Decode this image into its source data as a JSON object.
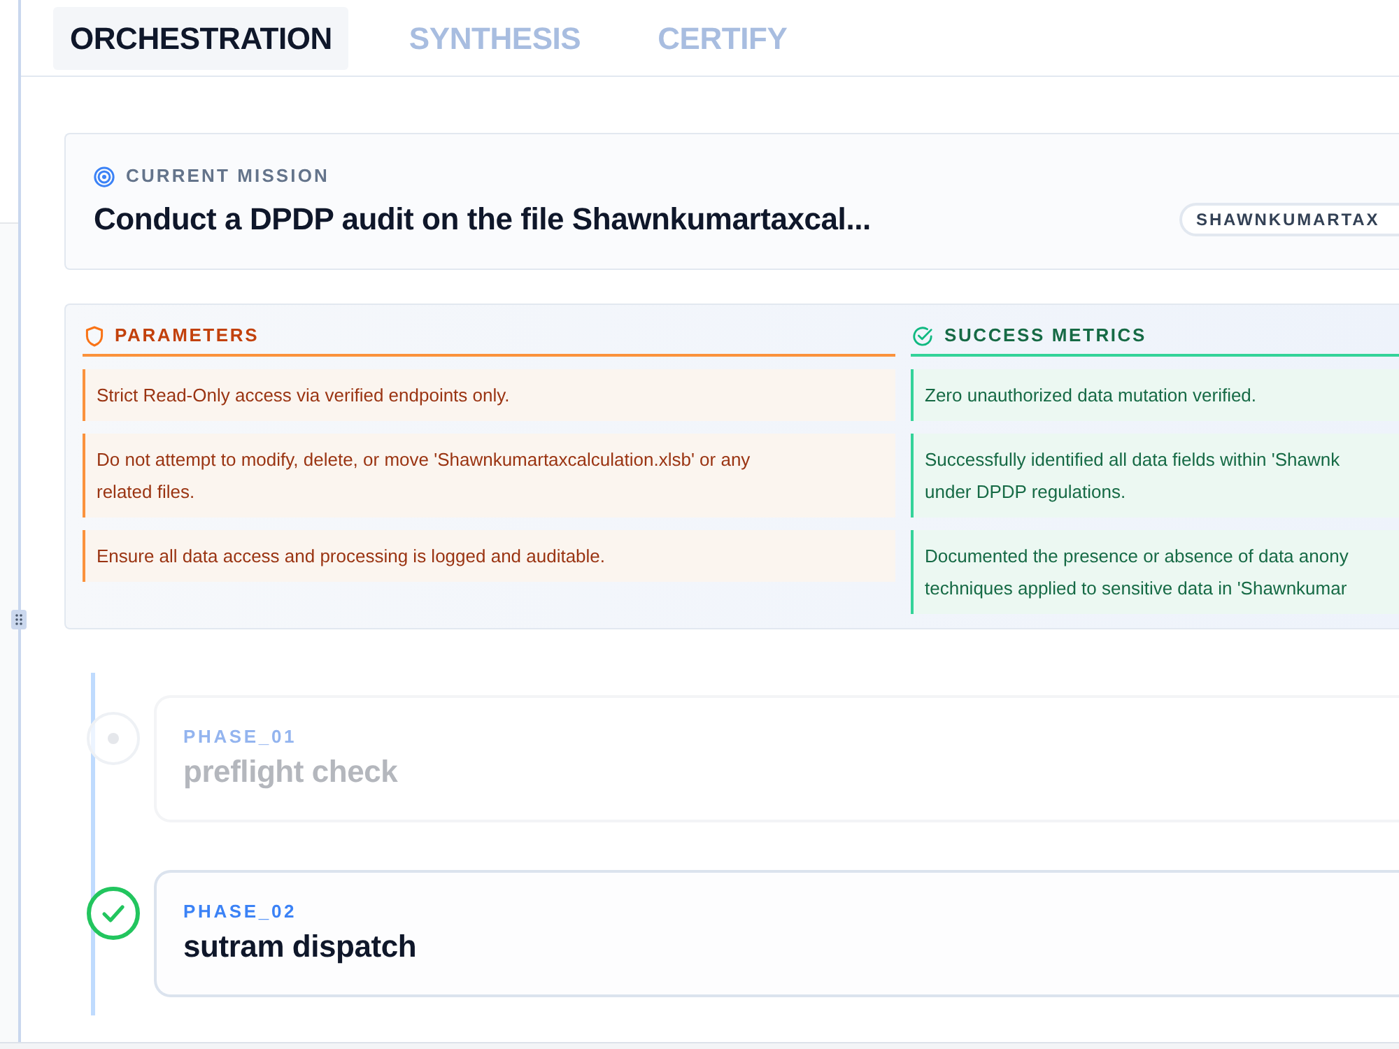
{
  "tabs": [
    {
      "label": "ORCHESTRATION",
      "selected": true
    },
    {
      "label": "SYNTHESIS",
      "selected": false
    },
    {
      "label": "CERTIFY",
      "selected": false
    }
  ],
  "mission": {
    "label": "CURRENT MISSION",
    "title": "Conduct a DPDP audit on the file Shawnkumartaxcal...",
    "badge": "SHAWNKUMARTAX"
  },
  "parameters": {
    "heading": "PARAMETERS",
    "items": [
      "Strict Read-Only access via verified endpoints only.",
      "Do not attempt to modify, delete, or move 'Shawnkumartaxcalculation.xlsb' or any\nrelated files.",
      "Ensure all data access and processing is logged and auditable."
    ]
  },
  "success_metrics": {
    "heading": "SUCCESS METRICS",
    "items": [
      "Zero unauthorized data mutation verified.",
      "Successfully identified all data fields within 'Shawnk\nunder DPDP regulations.",
      "Documented the presence or absence of data anony\ntechniques applied to sensitive data in 'Shawnkumar"
    ]
  },
  "phases": [
    {
      "label": "PHASE_01",
      "title": "preflight check",
      "completed": false
    },
    {
      "label": "PHASE_02",
      "title": "sutram dispatch",
      "completed": true
    }
  ]
}
